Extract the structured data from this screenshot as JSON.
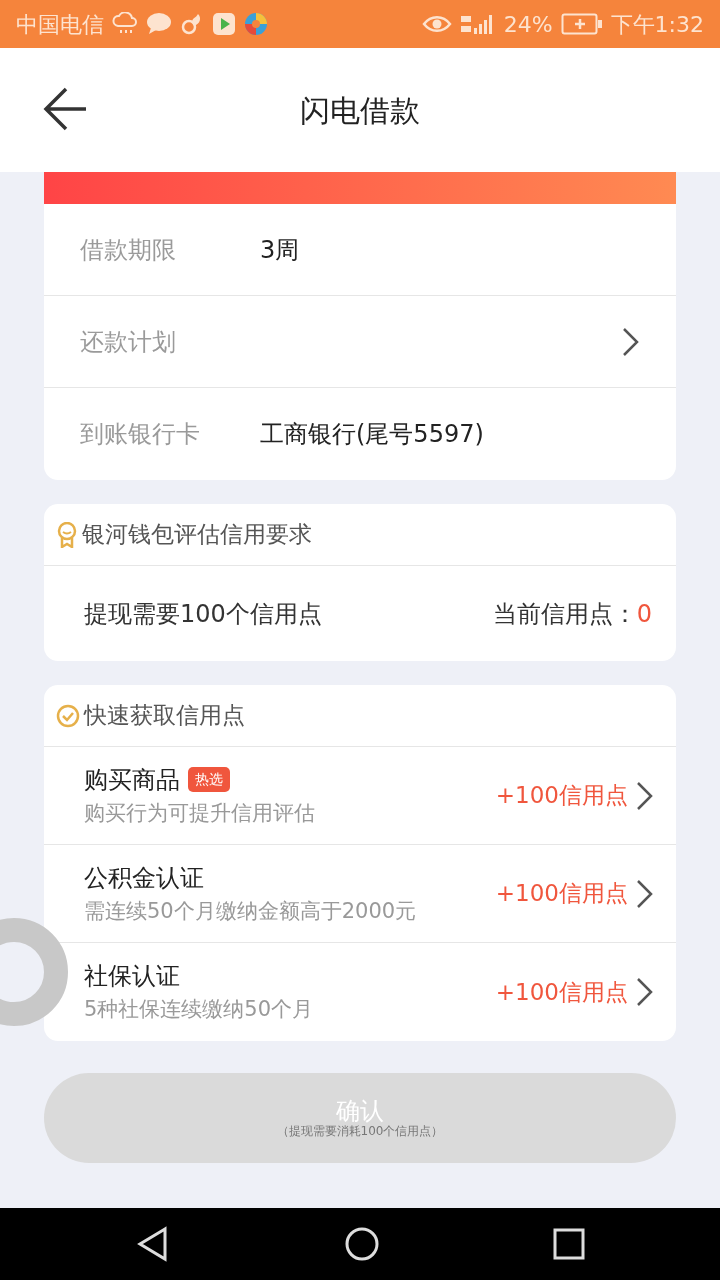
{
  "status_bar": {
    "carrier": "中国电信",
    "battery": "24%",
    "time": "下午1:32"
  },
  "header": {
    "title": "闪电借款"
  },
  "loan_details": [
    {
      "kind": "value",
      "label": "借款期限",
      "value": "3周"
    },
    {
      "kind": "link",
      "label": "还款计划"
    },
    {
      "kind": "value",
      "label": "到账银行卡",
      "value": "工商银行(尾号5597)"
    }
  ],
  "credit_requirement": {
    "title": "银河钱包评估信用要求",
    "requirement": "提现需要100个信用点",
    "current_label": "当前信用点：",
    "current_value": "0"
  },
  "quick_credit": {
    "title": "快速获取信用点",
    "items": [
      {
        "title": "购买商品",
        "badge": "热选",
        "description": "购买行为可提升信用评估",
        "reward": "+100信用点"
      },
      {
        "title": "公积金认证",
        "description": "需连续50个月缴纳金额高于2000元",
        "reward": "+100信用点"
      },
      {
        "title": "社保认证",
        "description": "5种社保连续缴纳50个月",
        "reward": "+100信用点"
      }
    ]
  },
  "confirm_button": {
    "label": "确认",
    "note": "（提现需要消耗100个信用点）",
    "disabled": true
  }
}
